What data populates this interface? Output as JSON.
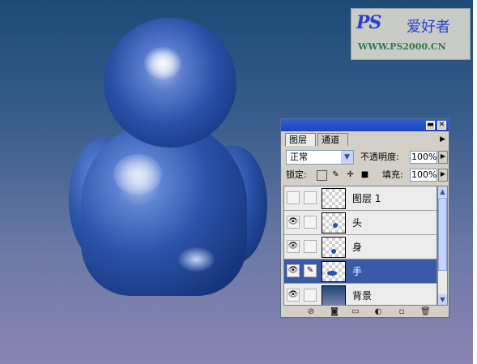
{
  "watermark": {
    "logo_text": "PS",
    "cn_text": "爱好者",
    "url_text": "WWW.PS2000.CN"
  },
  "panel": {
    "titlebar_buttons": [
      "minimize",
      "close"
    ],
    "tabs": [
      {
        "label": "图层",
        "active": true
      },
      {
        "label": "通道",
        "active": false
      }
    ],
    "menu_glyph": "▶",
    "blend_mode": "正常",
    "opacity_label": "不透明度:",
    "opacity_value": "100%",
    "lock_label": "锁定:",
    "fill_label": "填充:",
    "fill_value": "100%",
    "layers": [
      {
        "name": "图层 1",
        "visible": false,
        "brush": false,
        "selected": false
      },
      {
        "name": "头",
        "visible": true,
        "brush": false,
        "selected": false
      },
      {
        "name": "身",
        "visible": true,
        "brush": false,
        "selected": false
      },
      {
        "name": "手",
        "visible": true,
        "brush": true,
        "selected": true
      },
      {
        "name": "背景",
        "visible": true,
        "brush": false,
        "selected": false
      }
    ],
    "bottom_icons": [
      "link-layers-icon",
      "layer-style-icon",
      "add-mask-icon",
      "new-group-icon",
      "adjustment-layer-icon",
      "new-layer-icon",
      "delete-layer-icon"
    ]
  },
  "colors": {
    "canvas_top": "#1c4a76",
    "canvas_bottom": "#8a85b3",
    "selection": "#3a5aa8",
    "figure_blue": "#2a53a6"
  }
}
